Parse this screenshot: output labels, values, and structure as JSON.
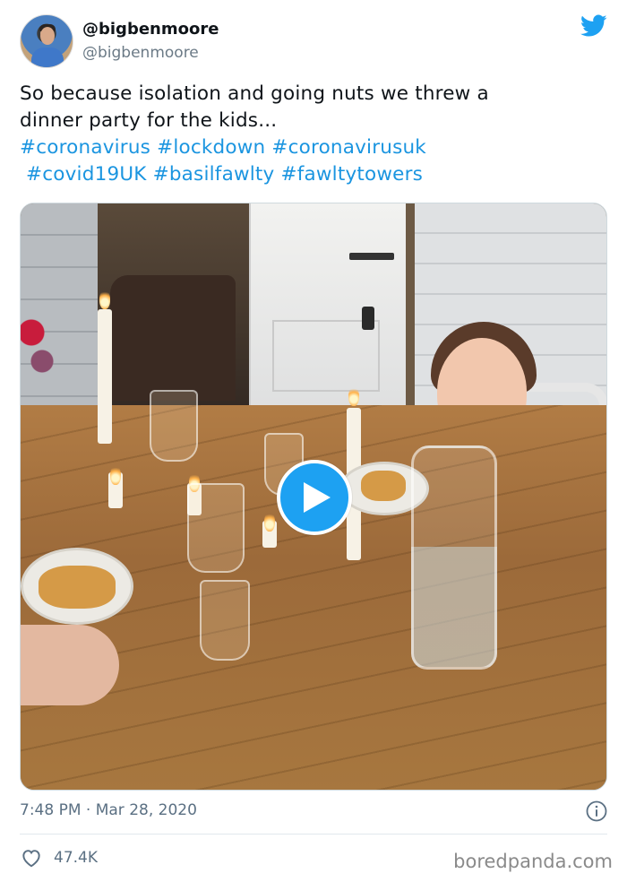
{
  "author": {
    "display_name": "@bigbenmoore",
    "handle": "@bigbenmoore",
    "avatar_icon": "profile-photo"
  },
  "brand": {
    "icon": "twitter-bird-icon",
    "color": "#1da1f2"
  },
  "tweet": {
    "text_line_1": "So because isolation and going nuts we threw a",
    "text_line_2": "dinner party for the kids...",
    "hashtags_line_1": [
      "#coronavirus",
      "#lockdown",
      "#coronavirusuk"
    ],
    "hashtags_line_2": [
      "#covid19UK",
      "#basilfawlty",
      "#fawltytowers"
    ],
    "hashtag_color": "#1b95e0"
  },
  "media": {
    "type": "video",
    "play_icon": "play-icon",
    "play_color": "#1da1f2"
  },
  "meta": {
    "time": "7:48 PM",
    "separator": "·",
    "date": "Mar 28, 2020",
    "info_icon": "info-icon"
  },
  "stats": {
    "like_icon": "heart-icon",
    "likes": "47.4K"
  },
  "watermark": "boredpanda.com"
}
